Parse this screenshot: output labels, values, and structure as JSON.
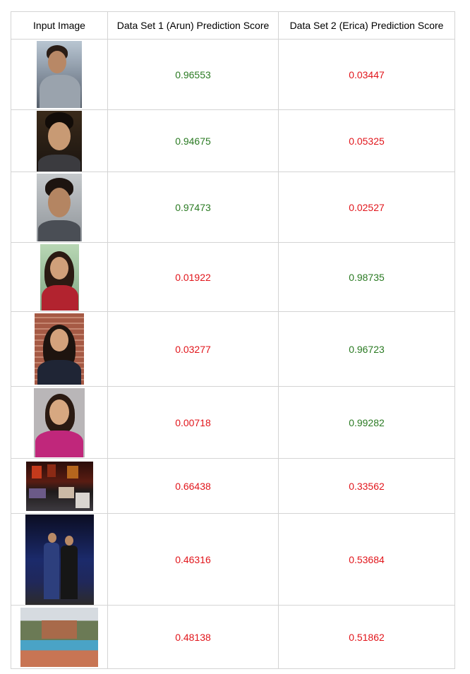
{
  "headers": [
    "Input Image",
    "Data Set 1 (Arun) Prediction Score",
    "Data Set 2 (Erica) Prediction Score"
  ],
  "colors": {
    "green": "#2a7a22",
    "red": "#e1151b",
    "border": "#d4d4d4"
  },
  "rows": [
    {
      "image": "photo-man-profile",
      "arun": "0.96553",
      "erica": "0.03447",
      "arun_color": "green",
      "erica_color": "red"
    },
    {
      "image": "photo-man-glasses-dark",
      "arun": "0.94675",
      "erica": "0.05325",
      "arun_color": "green",
      "erica_color": "red"
    },
    {
      "image": "photo-man-glasses-beard",
      "arun": "0.97473",
      "erica": "0.02527",
      "arun_color": "green",
      "erica_color": "red"
    },
    {
      "image": "photo-woman-red-top",
      "arun": "0.01922",
      "erica": "0.98735",
      "arun_color": "red",
      "erica_color": "green"
    },
    {
      "image": "photo-woman-brick-building",
      "arun": "0.03277",
      "erica": "0.96723",
      "arun_color": "red",
      "erica_color": "green"
    },
    {
      "image": "photo-woman-pink-top",
      "arun": "0.00718",
      "erica": "0.99282",
      "arun_color": "red",
      "erica_color": "green"
    },
    {
      "image": "photo-books-table",
      "arun": "0.66438",
      "erica": "0.33562",
      "arun_color": "red",
      "erica_color": "red"
    },
    {
      "image": "photo-couple-night",
      "arun": "0.46316",
      "erica": "0.53684",
      "arun_color": "red",
      "erica_color": "red"
    },
    {
      "image": "photo-pool-building",
      "arun": "0.48138",
      "erica": "0.51862",
      "arun_color": "red",
      "erica_color": "red"
    }
  ]
}
